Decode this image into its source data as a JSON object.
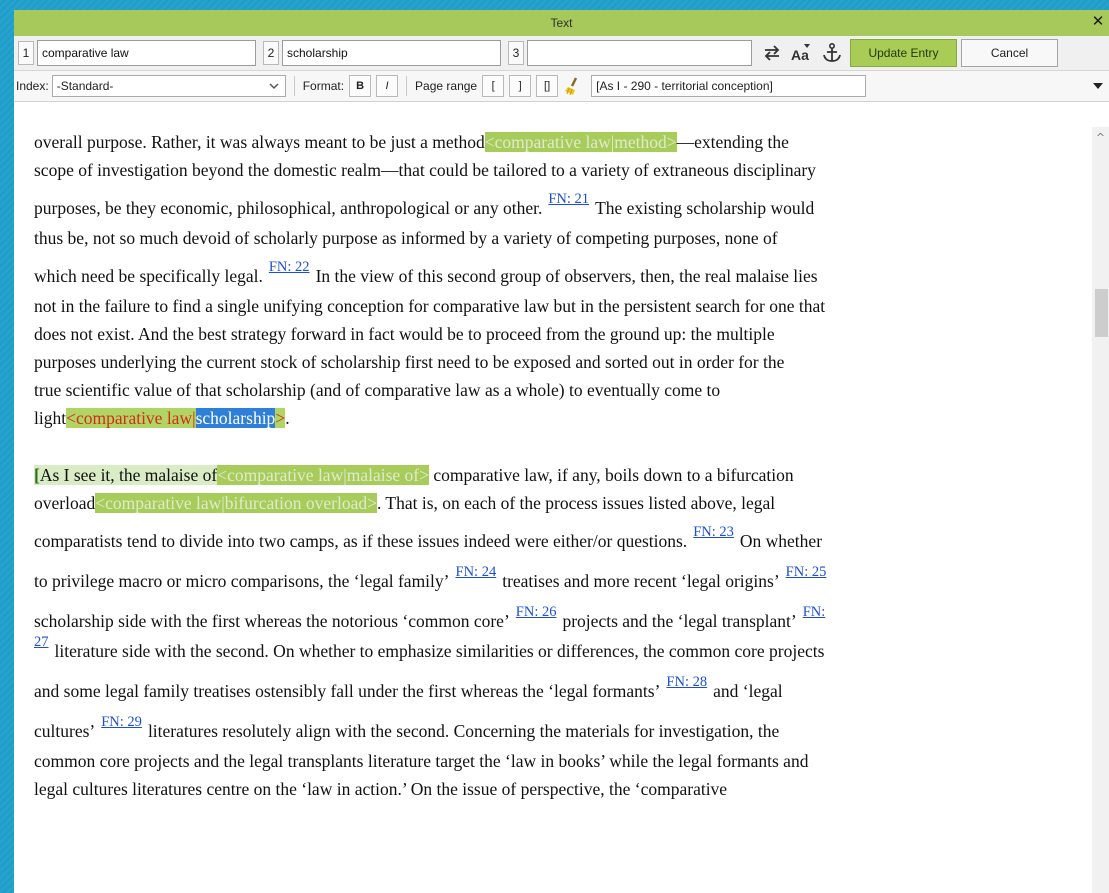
{
  "window": {
    "title": "Text"
  },
  "toolbar": {
    "field_numbers": [
      "1",
      "2",
      "3"
    ],
    "entry1": "comparative law",
    "entry2": "scholarship",
    "entry3": "",
    "update_label": "Update Entry",
    "cancel_label": "Cancel",
    "icons": [
      "swap-icon",
      "text-case-icon",
      "anchor-icon"
    ]
  },
  "indexbar": {
    "index_label": "Index:",
    "index_value": "-Standard-",
    "format_label": "Format:",
    "bold_label": "B",
    "italic_label": "I",
    "pagerange_label": "Page range",
    "bracket_open": "[",
    "bracket_close": "]",
    "bracket_both": "[]",
    "page_range_value": "[As I - 290 - territorial conception]"
  },
  "document": {
    "lines": [
      "overall purpose. Rather, it was always meant to be just a method",
      "<comparative law|method>",
      "—extending the",
      "scope of investigation beyond the domestic realm—that could be tailored to a variety of extraneous disciplinary",
      "purposes, be they economic, philosophical, anthropological or any other.",
      "The existing scholarship would",
      "thus be, not so much devoid of scholarly purpose as informed by a variety of competing purposes, none of",
      "which need be specifically legal.",
      "In the view of this second group of observers, then, the real malaise lies",
      "not in the failure to find a single unifying conception for comparative law but in the persistent search for one that",
      "does not exist. And the best strategy forward in fact would be to proceed from the ground up: the multiple",
      "purposes underlying the current stock of scholarship first need to be exposed and sorted out in order for the",
      "true scientific value of that scholarship (and of comparative law as a whole) to eventually come to",
      "light",
      "<comparative law|",
      "scholarship",
      ">",
      ".",
      "[",
      "As I see it, the malaise of",
      "<comparative law|malaise of>",
      " comparative law, if any, boils down to a bifurcation",
      "overload",
      "<comparative law|bifurcation overload>",
      ". That is, on each of the process issues listed above, legal",
      "comparatists tend to divide into two camps, as if these issues indeed were either/or questions.",
      "On whether",
      "to privilege macro or micro comparisons, the ‘legal family’",
      "treatises and more recent ‘legal origins’",
      "scholarship side with the first whereas the notorious ‘common core’",
      "projects and the ‘legal transplant’",
      "literature side with the second. On whether to emphasize similarities or differences, the common core projects",
      "and some legal family treatises ostensibly fall under the first whereas the ‘legal formants’",
      "and ‘legal",
      "cultures’",
      "literatures resolutely align with the second. Concerning the materials for investigation, the",
      "common core projects and the legal transplants literature target the ‘law in books’ while the legal formants and",
      "legal cultures literatures centre on the ‘law in action.’ On the issue of perspective, the ‘comparative"
    ],
    "footnotes": [
      "FN: 21",
      "FN: 22",
      "FN: 23",
      "FN: 24",
      "FN: 25",
      "FN: 26",
      "FN:",
      "27",
      "FN: 28",
      "FN: 29"
    ]
  },
  "colors": {
    "accent_green": "#a7c85a",
    "tag_green": "#a8cc5a",
    "selection_blue": "#2d7fd7",
    "link_blue": "#1b4fd6",
    "active_tag_red": "#d52b1e",
    "desktop": "#1f9ec9"
  }
}
